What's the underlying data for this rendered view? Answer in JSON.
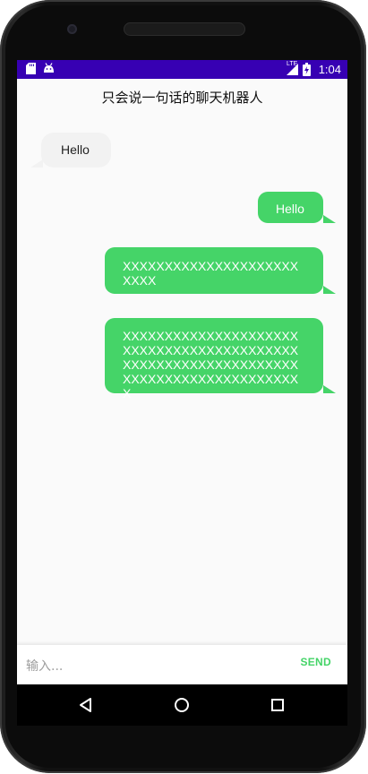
{
  "status_bar": {
    "time": "1:04",
    "network_label": "LTE",
    "icons": [
      "sd-card-icon",
      "android-icon",
      "signal-icon",
      "battery-charging-icon"
    ]
  },
  "app": {
    "title": "只会说一句话的聊天机器人"
  },
  "messages": [
    {
      "side": "left",
      "text": "Hello"
    },
    {
      "side": "right",
      "text": "Hello"
    },
    {
      "side": "right",
      "text": "XXXXXXXXXXXXXXXXXXXXXXXXX"
    },
    {
      "side": "right",
      "text": "XXXXXXXXXXXXXXXXXXXXXXXXXXXXXXXXXXXXXXXXXXXXXXXXXXXXXXXXXXXXXXXXXXXXXXXXXXXXXXXXXXXXX"
    }
  ],
  "composer": {
    "placeholder": "输入...",
    "send_label": "SEND"
  },
  "navigation": {
    "icons": [
      "back-icon",
      "home-icon",
      "recents-icon"
    ]
  },
  "colors": {
    "status_bar": "#3700b3",
    "sent_bubble": "#45d468",
    "received_bubble": "#f2f2f2",
    "send_button": "#45d468"
  }
}
